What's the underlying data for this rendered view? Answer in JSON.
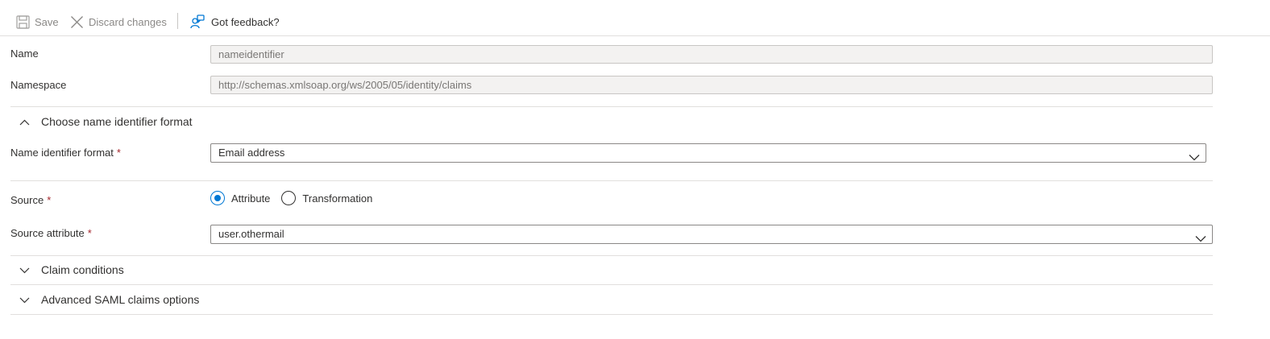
{
  "toolbar": {
    "save_label": "Save",
    "discard_label": "Discard changes",
    "feedback_label": "Got feedback?"
  },
  "fields": {
    "name": {
      "label": "Name",
      "value": "nameidentifier"
    },
    "namespace": {
      "label": "Namespace",
      "value": "http://schemas.xmlsoap.org/ws/2005/05/identity/claims"
    }
  },
  "name_identifier_section": {
    "title": "Choose name identifier format",
    "format_label": "Name identifier format",
    "format_value": "Email address"
  },
  "source": {
    "label": "Source",
    "options": [
      {
        "label": "Attribute",
        "selected": true
      },
      {
        "label": "Transformation",
        "selected": false
      }
    ]
  },
  "source_attribute": {
    "label": "Source attribute",
    "value": "user.othermail"
  },
  "required_marker": "*",
  "sections": {
    "claim_conditions": "Claim conditions",
    "advanced_saml": "Advanced SAML claims options"
  },
  "colors": {
    "accent": "#0078d4",
    "required": "#a4262c",
    "border": "#e1dfdd"
  },
  "icons": [
    "save-icon",
    "discard-icon",
    "feedback-icon",
    "chevron-up-icon",
    "chevron-down-icon"
  ]
}
